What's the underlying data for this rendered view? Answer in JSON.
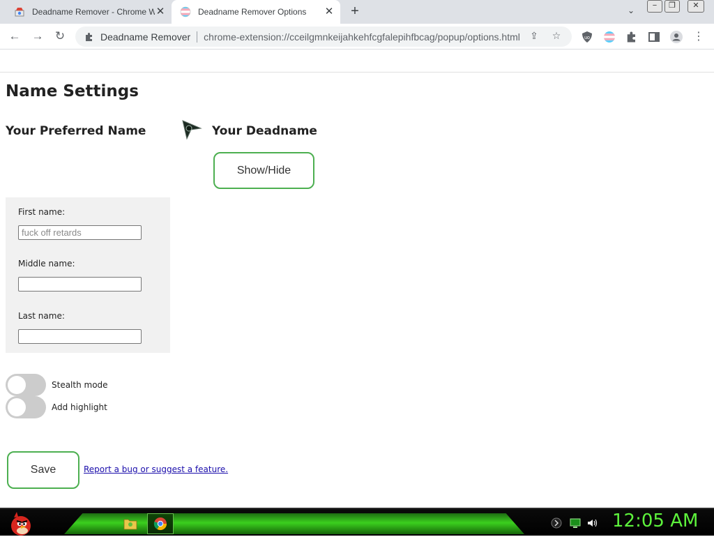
{
  "browser": {
    "tabs": [
      {
        "title": "Deadname Remover - Chrome W",
        "active": false
      },
      {
        "title": "Deadname Remover Options",
        "active": true
      }
    ],
    "omnibox": {
      "site": "Deadname Remover",
      "url": "chrome-extension://cceilgmnkeijahkehfcgfalepihfbcag/popup/options.html"
    }
  },
  "page": {
    "title": "Name Settings",
    "preferred_heading": "Your Preferred Name",
    "deadname_heading": "Your Deadname",
    "show_hide_label": "Show/Hide",
    "fields": {
      "first_label": "First name:",
      "first_placeholder": "fuck off retards",
      "middle_label": "Middle name:",
      "last_label": "Last name:"
    },
    "toggles": {
      "stealth_label": "Stealth mode",
      "stealth_on": false,
      "highlight_label": "Add highlight",
      "highlight_on": false
    },
    "save_label": "Save",
    "report_link": "Report a bug or suggest a feature."
  },
  "taskbar": {
    "clock": "12:05 AM"
  },
  "colors": {
    "button_border": "#4caf50",
    "link": "#1a0dab",
    "clock": "#5df23c"
  }
}
